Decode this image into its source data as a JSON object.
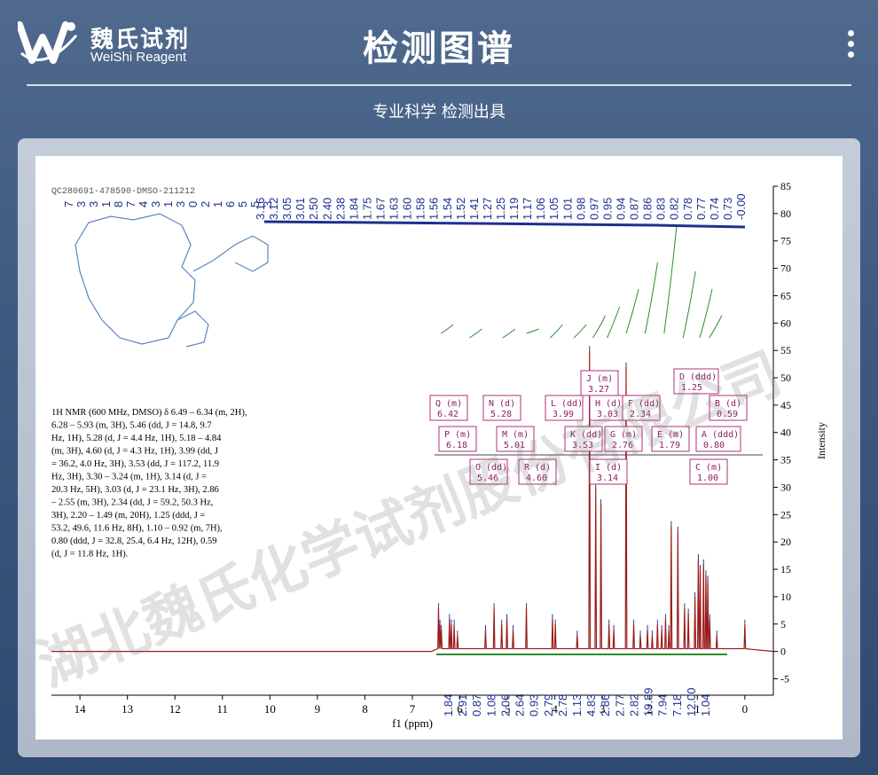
{
  "brand": {
    "name_cn": "魏氏试剂",
    "name_en": "WeiShi Reagent"
  },
  "header": {
    "title": "检测图谱",
    "subtitle": "专业科学  检测出具"
  },
  "watermark": "湖北魏氏化学试剂股份有限公司",
  "spectrum": {
    "sample_id": "QC280691-478590-DMSO-211212",
    "description": "1H NMR (600 MHz, DMSO) δ 6.49 – 6.34 (m, 2H), 6.28 – 5.93 (m, 3H), 5.46 (dd, J = 14.8, 9.7 Hz, 1H), 5.28 (d, J = 4.4 Hz, 1H), 5.18 – 4.84 (m, 3H), 4.60 (d, J = 4.3 Hz, 1H), 3.99 (dd, J = 36.2, 4.0 Hz, 3H), 3.53 (dd, J = 117.2, 11.9 Hz, 3H), 3.30 – 3.24 (m, 1H), 3.14 (d, J = 20.3 Hz, 5H), 3.03 (d, J = 23.1 Hz, 3H), 2.86 – 2.55 (m, 3H), 2.34 (dd, J = 59.2, 50.3 Hz, 3H), 2.20 – 1.49 (m, 20H), 1.25 (ddd, J = 53.2, 49.6, 11.6 Hz, 8H), 1.10 – 0.92 (m, 7H), 0.80 (ddd, J = 32.8, 25.4, 6.4 Hz, 12H), 0.59 (d, J = 11.8 Hz, 1H).",
    "top_left_stack": [
      "7",
      "3",
      "3",
      "1",
      "8",
      "7",
      "4",
      "3",
      "1",
      "3",
      "0",
      "2",
      "1",
      "6",
      "5",
      "5",
      "3"
    ],
    "peak_labels": [
      "3.16",
      "3.12",
      "3.05",
      "3.01",
      "2.50",
      "2.40",
      "2.38",
      "1.84",
      "1.75",
      "1.67",
      "1.63",
      "1.60",
      "1.58",
      "1.56",
      "1.54",
      "1.52",
      "1.41",
      "1.27",
      "1.25",
      "1.19",
      "1.17",
      "1.06",
      "1.05",
      "1.01",
      "0.98",
      "0.97",
      "0.95",
      "0.94",
      "0.87",
      "0.86",
      "0.83",
      "0.82",
      "0.78",
      "0.77",
      "0.74",
      "0.73",
      "-0.00"
    ],
    "integrals": [
      "1.84",
      "2.91",
      "0.87",
      "1.08",
      "2.06",
      "2.64",
      "0.93",
      "2.79",
      "2.78",
      "1.13",
      "4.83",
      "2.86",
      "2.77",
      "2.82",
      "19.89",
      "7.94",
      "7.18",
      "12.00",
      "1.04"
    ]
  },
  "multiplets": [
    {
      "id": "Q",
      "type": "(m)",
      "shift": "6.42"
    },
    {
      "id": "N",
      "type": "(d)",
      "shift": "5.28"
    },
    {
      "id": "L",
      "type": "(dd)",
      "shift": "3.99"
    },
    {
      "id": "J",
      "type": "(m)",
      "shift": "3.27"
    },
    {
      "id": "H",
      "type": "(d)",
      "shift": "3.03"
    },
    {
      "id": "F",
      "type": "(dd)",
      "shift": "2.34"
    },
    {
      "id": "D",
      "type": "(ddd)",
      "shift": "1.25"
    },
    {
      "id": "B",
      "type": "(d)",
      "shift": "0.59"
    },
    {
      "id": "P",
      "type": "(m)",
      "shift": "6.18"
    },
    {
      "id": "M",
      "type": "(m)",
      "shift": "5.01"
    },
    {
      "id": "K",
      "type": "(dd)",
      "shift": "3.53"
    },
    {
      "id": "G",
      "type": "(m)",
      "shift": "2.76"
    },
    {
      "id": "E",
      "type": "(m)",
      "shift": "1.79"
    },
    {
      "id": "A",
      "type": "(ddd)",
      "shift": "0.80"
    },
    {
      "id": "O",
      "type": "(dd)",
      "shift": "5.46"
    },
    {
      "id": "R",
      "type": "(d)",
      "shift": "4.60"
    },
    {
      "id": "I",
      "type": "(d)",
      "shift": "3.14"
    },
    {
      "id": "C",
      "type": "(m)",
      "shift": "1.00"
    }
  ],
  "chart_data": {
    "type": "line",
    "xlabel": "f1 (ppm)",
    "ylabel": "Intensity",
    "xlim": [
      14.6,
      -0.6
    ],
    "ylim": [
      -8,
      85
    ],
    "x_ticks": [
      14,
      13,
      12,
      11,
      10,
      9,
      8,
      7,
      6,
      5,
      4,
      3,
      2,
      1,
      0
    ],
    "y_ticks": [
      -5,
      0,
      5,
      10,
      15,
      20,
      25,
      30,
      35,
      40,
      45,
      50,
      55,
      60,
      65,
      70,
      75,
      80,
      85
    ],
    "grid": false,
    "series": [
      {
        "x": [
          6.45,
          6.42,
          6.39,
          6.22,
          6.18,
          6.12,
          6.05,
          5.46,
          5.28,
          5.12,
          5.01,
          4.88,
          4.6,
          4.05,
          3.99,
          3.53,
          3.27,
          3.14,
          3.03,
          2.86,
          2.76,
          2.5,
          2.34,
          2.2,
          2.05,
          1.95,
          1.84,
          1.75,
          1.67,
          1.6,
          1.55,
          1.41,
          1.27,
          1.19,
          1.05,
          0.98,
          0.94,
          0.87,
          0.82,
          0.78,
          0.74,
          0.59,
          0.0
        ],
        "y": [
          8,
          5,
          4,
          6,
          5,
          5,
          3,
          4,
          8,
          5,
          6,
          4,
          8,
          6,
          5,
          3,
          55,
          30,
          27,
          5,
          4,
          52,
          5,
          3,
          4,
          3,
          5,
          4,
          6,
          4,
          23,
          22,
          8,
          7,
          10,
          17,
          15,
          16,
          14,
          13,
          6,
          3,
          5
        ]
      }
    ]
  }
}
